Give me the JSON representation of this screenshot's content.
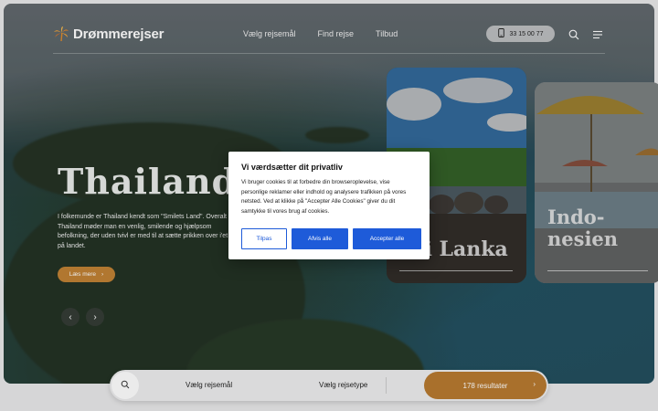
{
  "header": {
    "logo_text": "Drømmerejser",
    "nav": [
      "Vælg rejsemål",
      "Find rejse",
      "Tilbud"
    ],
    "phone": "33 15 00 77",
    "icons": [
      "phone-icon",
      "search-icon",
      "menu-icon"
    ]
  },
  "hero": {
    "title": "Thailand",
    "text": "I folkemunde er Thailand kendt som \"Smilets Land\". Overalt i Thailand møder man en venlig, smilende og hjælpsom befolkning, der uden tvivl er med til at sætte prikken over i'et på landet.",
    "cta": "Læs mere"
  },
  "cards": [
    {
      "caption": "Sri Lanka"
    },
    {
      "caption": "Indo-nesien"
    }
  ],
  "search": {
    "field_1": "Vælg rejsemål",
    "field_2": "Vælg rejsetype",
    "results": "178 resultater"
  },
  "cookie": {
    "title": "Vi værdsætter dit privatliv",
    "body": "Vi bruger cookies til at forbedre din browseroplevelse, vise personlige reklamer eller indhold og analysere trafikken på vores netsted. Ved at klikke på \"Accepter Alle Cookies\" giver du dit samtykke til vores brug af cookies.",
    "btn_customize": "Tilpas",
    "btn_reject": "Afvis alle",
    "btn_accept": "Accepter alle"
  },
  "colors": {
    "accent_gold": "#c08235",
    "consent_blue": "#1e5bd9"
  }
}
